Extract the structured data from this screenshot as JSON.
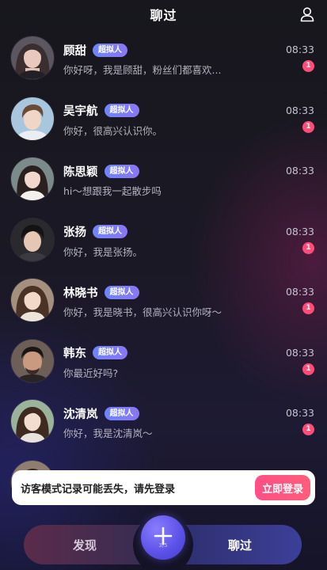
{
  "header": {
    "title": "聊过"
  },
  "chats": [
    {
      "name": "顾甜",
      "badge": "超拟人",
      "preview": "你好呀，我是顾甜，粉丝们都喜欢...",
      "time": "08:33",
      "unread": "1"
    },
    {
      "name": "吴宇航",
      "badge": "超拟人",
      "preview": "你好，很高兴认识你。",
      "time": "08:33",
      "unread": "1"
    },
    {
      "name": "陈思颖",
      "badge": "超拟人",
      "preview": "hi～想跟我一起散步吗",
      "time": "08:33",
      "unread": ""
    },
    {
      "name": "张扬",
      "badge": "超拟人",
      "preview": "你好，我是张扬。",
      "time": "08:33",
      "unread": "1"
    },
    {
      "name": "林晓书",
      "badge": "超拟人",
      "preview": "你好，我是晓书，很高兴认识你呀～",
      "time": "08:33",
      "unread": "1"
    },
    {
      "name": "韩东",
      "badge": "超拟人",
      "preview": "你最近好吗?",
      "time": "08:33",
      "unread": "1"
    },
    {
      "name": "沈清岚",
      "badge": "超拟人",
      "preview": "你好，我是沈清岚～",
      "time": "08:33",
      "unread": "1"
    },
    {
      "name": "",
      "badge": "",
      "preview": "",
      "time": "",
      "unread": ""
    }
  ],
  "toast": {
    "text": "访客模式记录可能丢失，请先登录",
    "button": "立即登录"
  },
  "nav": {
    "discover": "发现",
    "chat": "聊过",
    "create_sub": "3/5"
  },
  "colors": {
    "accent_pink": "#ff4d77",
    "badge_blue": "#7a7ef8",
    "create_purple": "#5a50e6"
  },
  "icons": {
    "profile": "person-icon",
    "create": "plus-icon"
  }
}
